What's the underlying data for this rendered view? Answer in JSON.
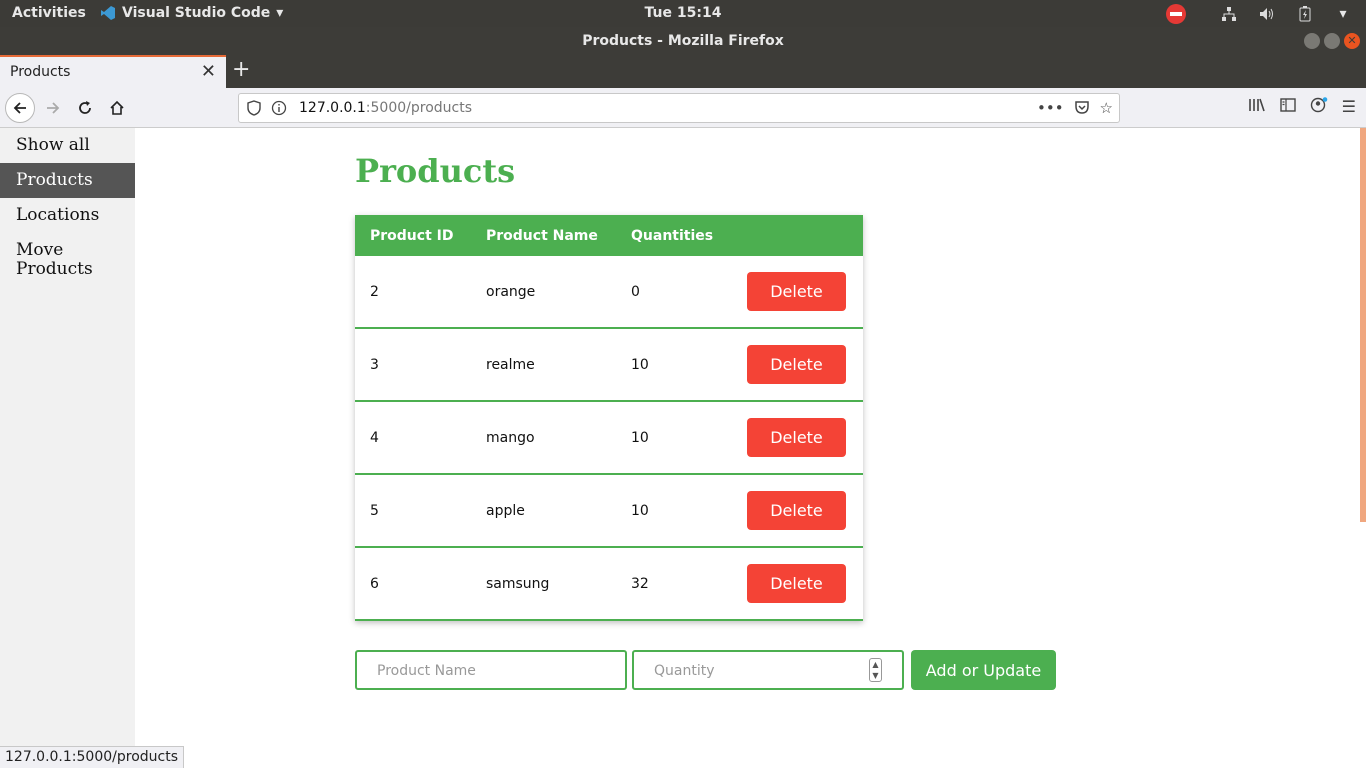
{
  "system": {
    "activities": "Activities",
    "app_name": "Visual Studio Code",
    "clock": "Tue 15:14"
  },
  "window": {
    "title": "Products - Mozilla Firefox"
  },
  "browser": {
    "tab_title": "Products",
    "url_host": "127.0.0.1",
    "url_rest": ":5000/products",
    "status_url": "127.0.0.1:5000/products"
  },
  "sidebar": {
    "items": [
      {
        "label": "Show all"
      },
      {
        "label": "Products"
      },
      {
        "label": "Locations"
      },
      {
        "label": "Move Products"
      }
    ],
    "active_index": 1
  },
  "page": {
    "title": "Products"
  },
  "table": {
    "headers": [
      "Product ID",
      "Product Name",
      "Quantities"
    ],
    "delete_label": "Delete",
    "rows": [
      {
        "id": "2",
        "name": "orange",
        "qty": "0"
      },
      {
        "id": "3",
        "name": "realme",
        "qty": "10"
      },
      {
        "id": "4",
        "name": "mango",
        "qty": "10"
      },
      {
        "id": "5",
        "name": "apple",
        "qty": "10"
      },
      {
        "id": "6",
        "name": "samsung",
        "qty": "32"
      }
    ]
  },
  "form": {
    "name_placeholder": "Product Name",
    "qty_placeholder": "Quantity",
    "submit_label": "Add or Update"
  },
  "colors": {
    "accent": "#4caf50",
    "danger": "#f44336",
    "sidebar_active": "#555555"
  }
}
